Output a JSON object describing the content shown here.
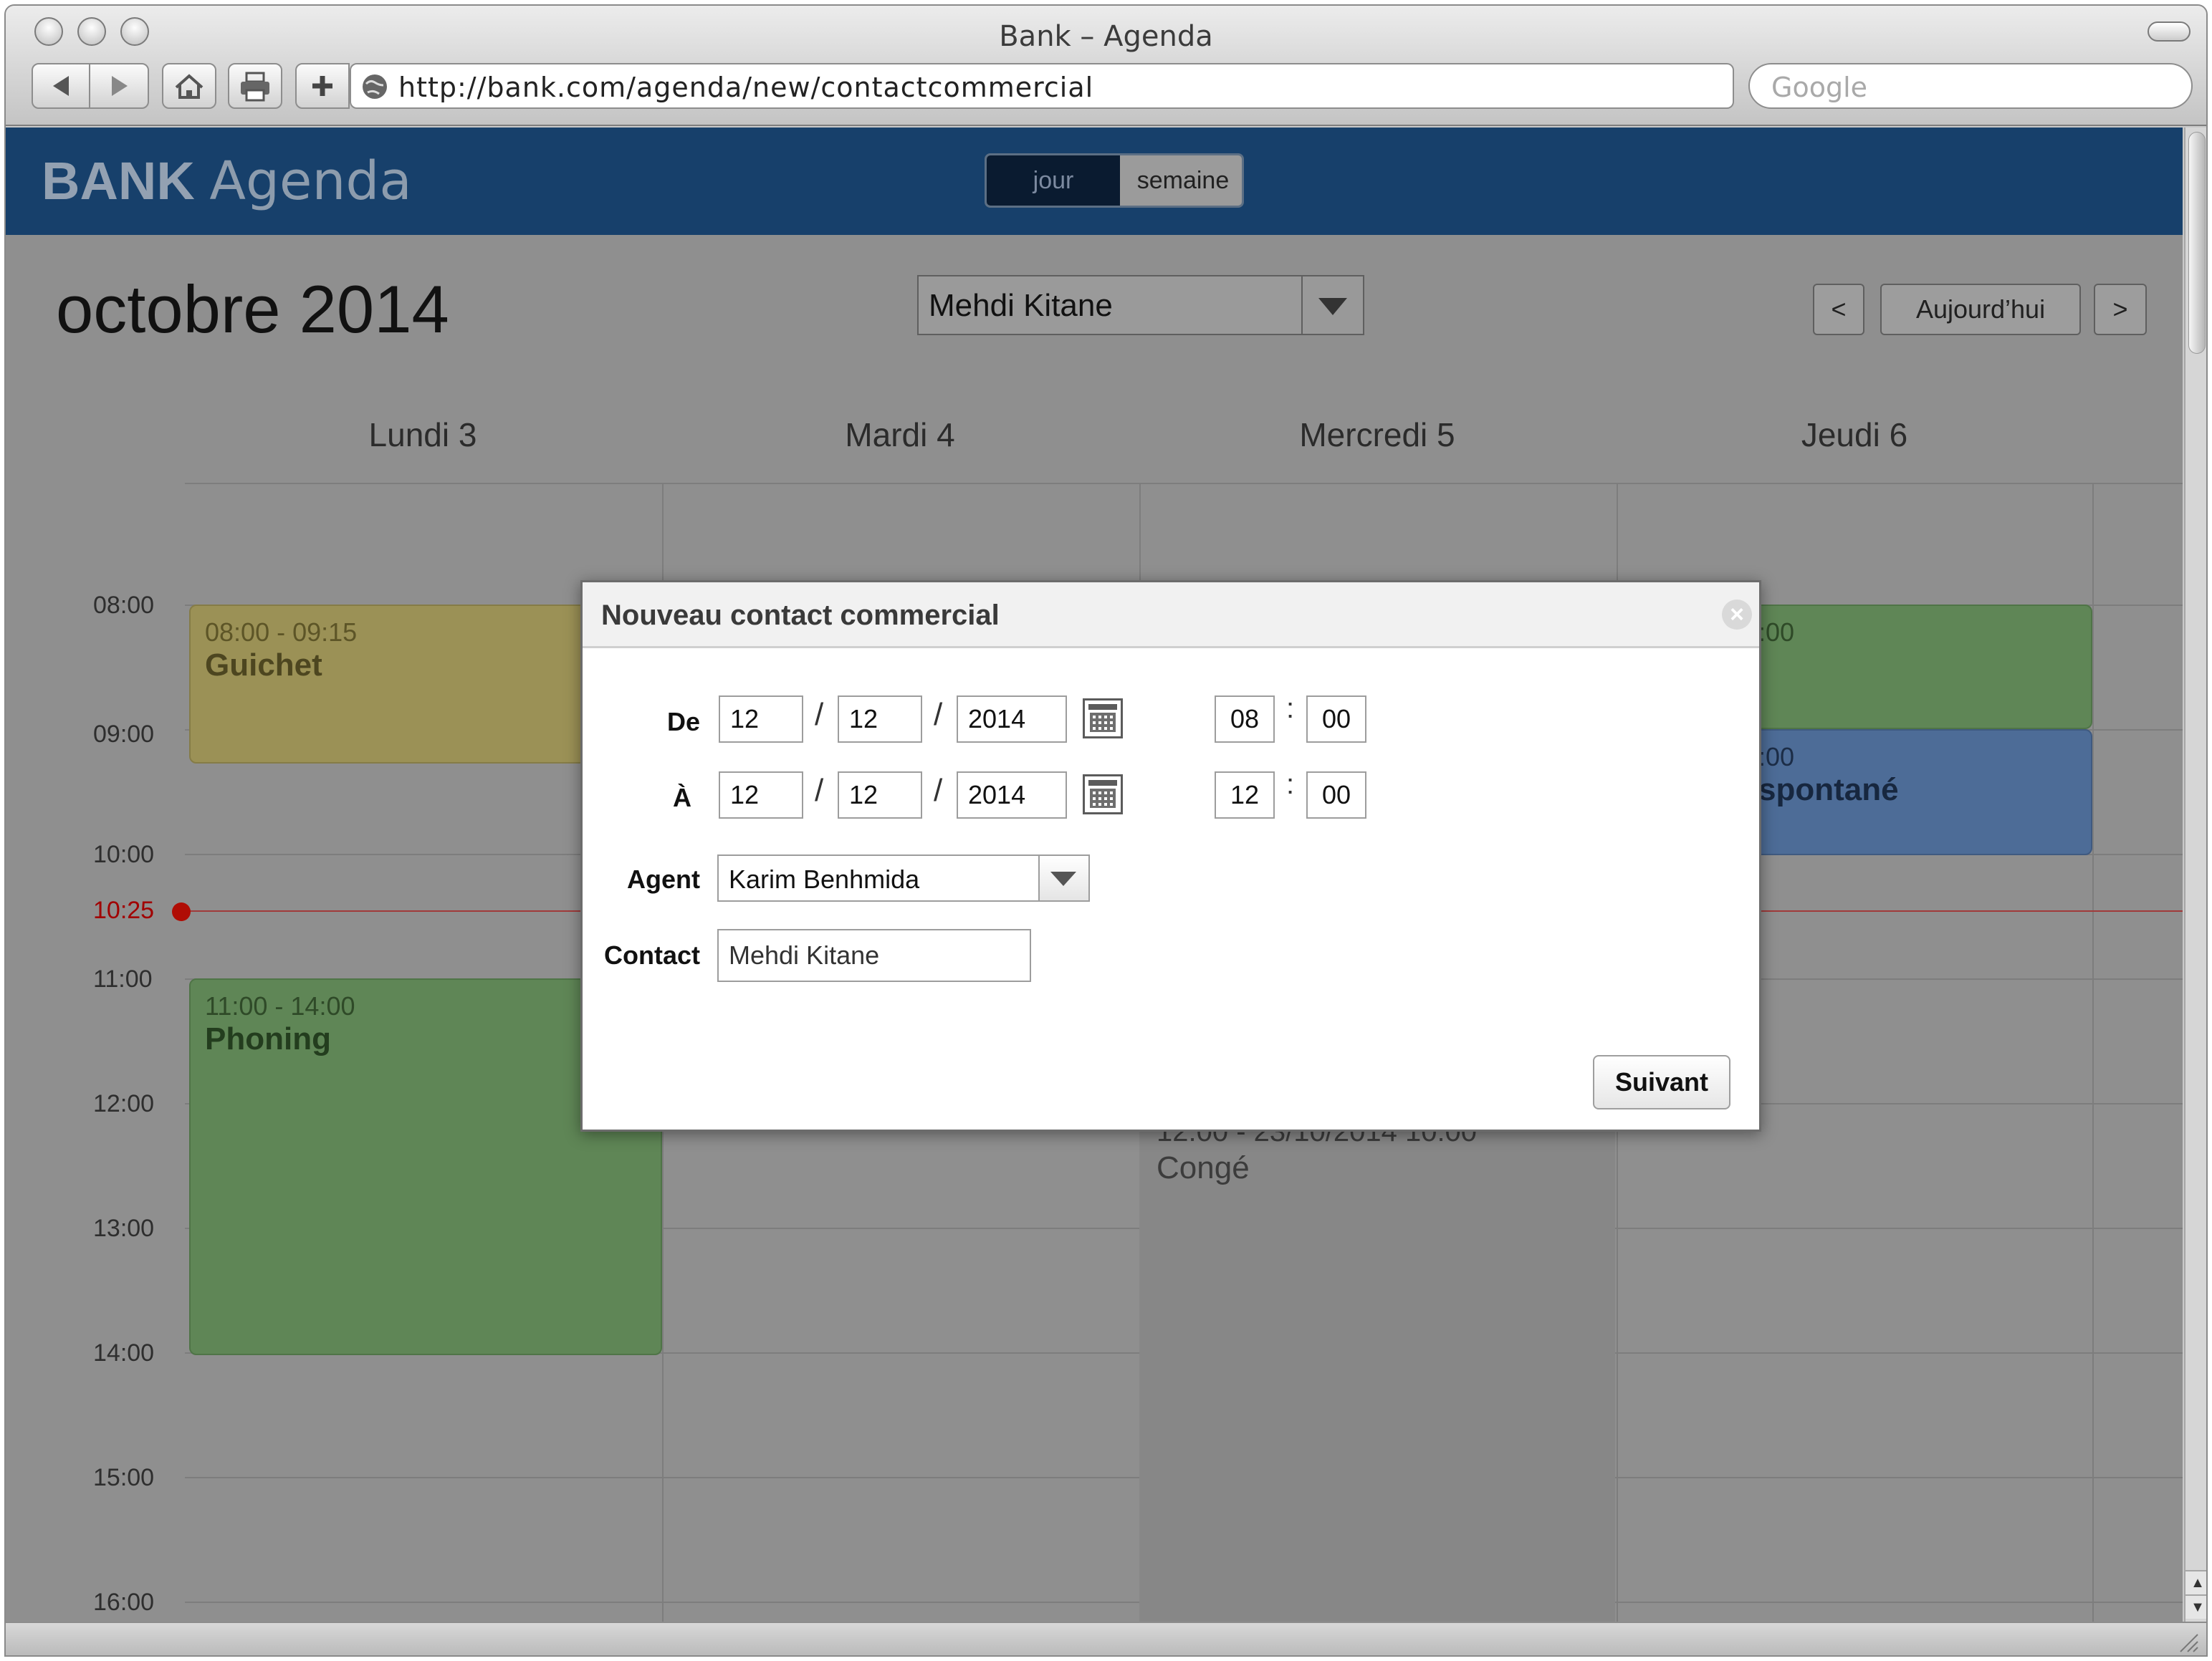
{
  "browser": {
    "window_title": "Bank – Agenda",
    "url": "http://bank.com/agenda/new/contactcommercial",
    "search_placeholder": "Google"
  },
  "app": {
    "brand_bold": "BANK",
    "brand_light": "Agenda",
    "view_toggle": {
      "day": "jour",
      "week": "semaine",
      "selected": "jour"
    },
    "month_title": "octobre 2014",
    "agent_select": "Mehdi Kitane",
    "nav": {
      "prev": "<",
      "today": "Aujourd’hui",
      "next": ">"
    },
    "days": [
      "Lundi 3",
      "Mardi 4",
      "Mercredi 5",
      "Jeudi 6"
    ],
    "hours": [
      "08:00",
      "09:00",
      "10:00",
      "11:00",
      "12:00",
      "13:00",
      "14:00",
      "15:00",
      "16:00"
    ],
    "now_label": "10:25",
    "events": [
      {
        "time": "08:00 - 09:15",
        "name": "Guichet",
        "color": "#9b9156"
      },
      {
        "time": "11:00 - 14:00",
        "name": "Phoning",
        "color": "#5f8656"
      },
      {
        "time": ":00",
        "name": "",
        "color": "#5f8656"
      },
      {
        "time": ":00",
        "name": "spontané",
        "color": "#4d6c97"
      }
    ],
    "conge": {
      "time": "12:00 - 23/10/2014 10:00",
      "name": "Congé"
    }
  },
  "modal": {
    "title": "Nouveau contact commercial",
    "close_icon": "×",
    "from_label": "De",
    "from": {
      "day": "12",
      "month": "12",
      "year": "2014",
      "hour": "08",
      "minute": "00"
    },
    "to_label": "À",
    "to": {
      "day": "12",
      "month": "12",
      "year": "2014",
      "hour": "12",
      "minute": "00"
    },
    "date_sep": "/",
    "time_sep": ":",
    "agent_label": "Agent",
    "agent_value": "Karim Benhmida",
    "contact_label": "Contact",
    "contact_value": "Mehdi Kitane",
    "next_button": "Suivant"
  }
}
